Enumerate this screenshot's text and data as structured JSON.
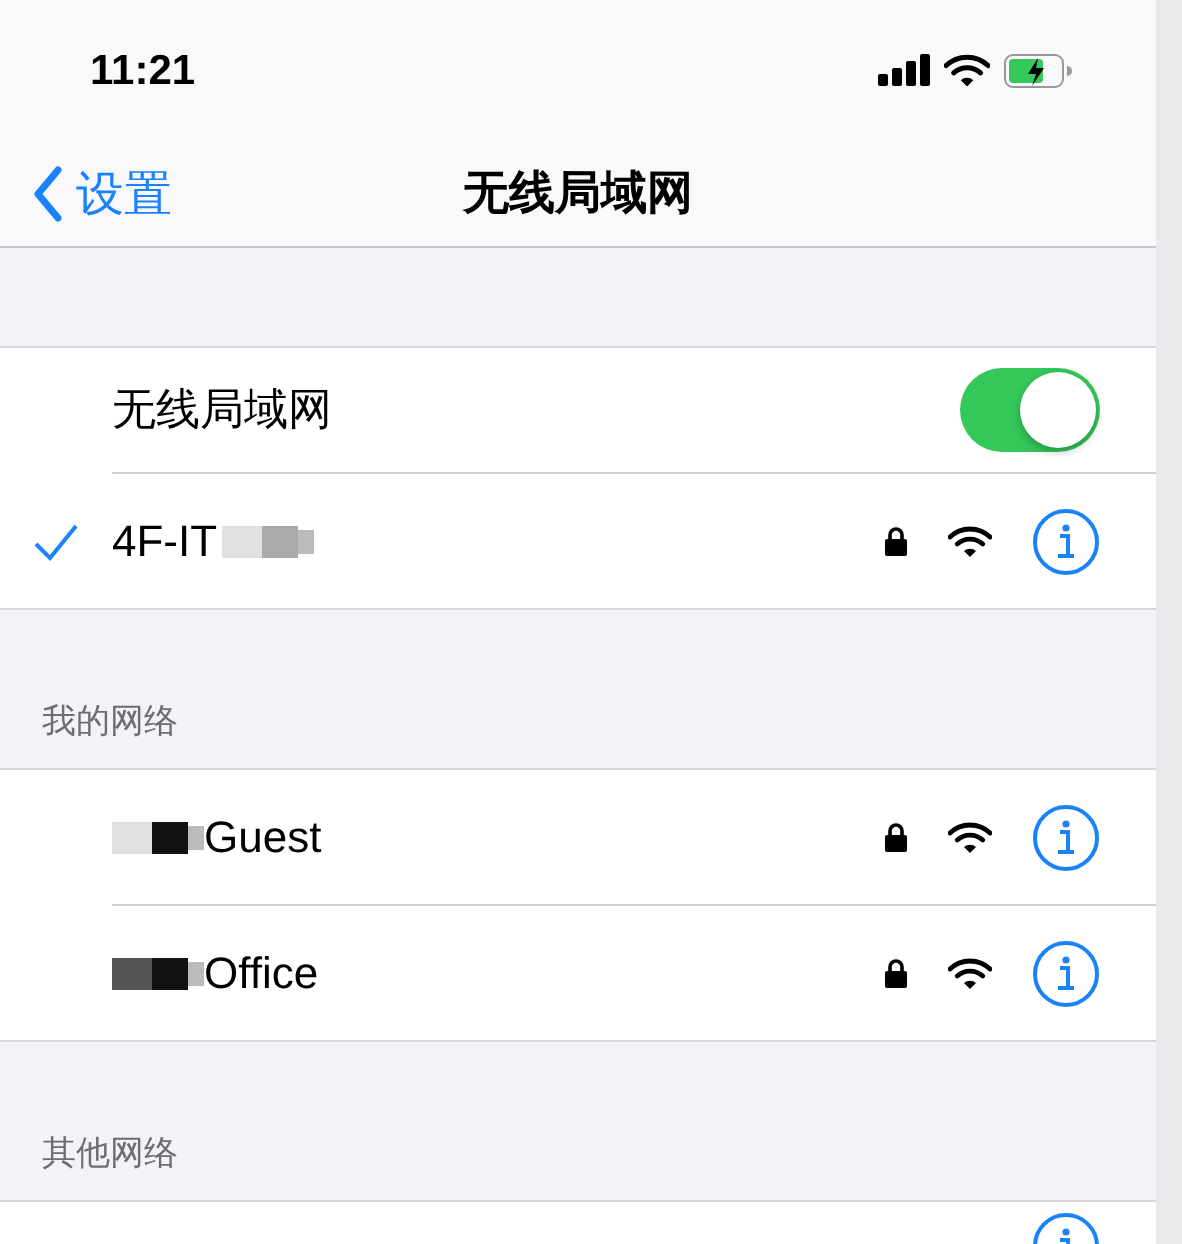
{
  "status_bar": {
    "time": "11:21",
    "battery_charging": true
  },
  "nav_bar": {
    "back_label": "设置",
    "title": "无线局域网"
  },
  "wifi_toggle": {
    "label": "无线局域网",
    "on": true
  },
  "current_networks": [
    {
      "name": "4F-IT",
      "connected": true,
      "secured": true,
      "redacted": true
    }
  ],
  "sections": [
    {
      "header": "我的网络",
      "networks": [
        {
          "name": "Guest",
          "connected": false,
          "secured": true,
          "redacted": true
        },
        {
          "name": "Office",
          "connected": false,
          "secured": true,
          "redacted": true
        }
      ]
    },
    {
      "header": "其他网络",
      "networks": [
        {
          "connected": false,
          "secured": false,
          "redacted": false,
          "cut": true
        }
      ]
    }
  ]
}
